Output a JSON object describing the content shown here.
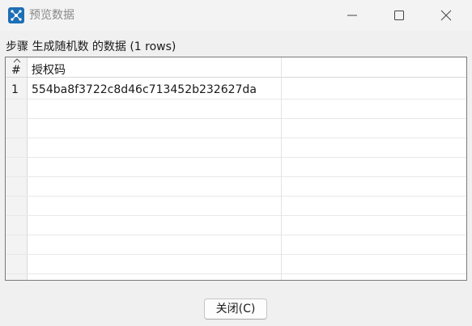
{
  "window": {
    "title": "预览数据",
    "icon": "app-logo-icon",
    "controls": [
      "minimize-icon",
      "maximize-icon",
      "close-icon"
    ]
  },
  "caption": "步骤 生成随机数 的数据  (1 rows)",
  "table": {
    "row_number_header": "#",
    "columns": [
      "授权码",
      ""
    ],
    "rows": [
      {
        "num": "1",
        "cells": [
          "554ba8f3722c8d46c713452b232627da",
          ""
        ]
      }
    ]
  },
  "footer": {
    "close_label": "关闭(C)"
  },
  "colors": {
    "accent": "#1e6fb5",
    "window_bg": "#f0f0f0",
    "grid_bg": "#ffffff",
    "gridline": "#e8e8e8",
    "title_text": "#8a8a8a"
  }
}
